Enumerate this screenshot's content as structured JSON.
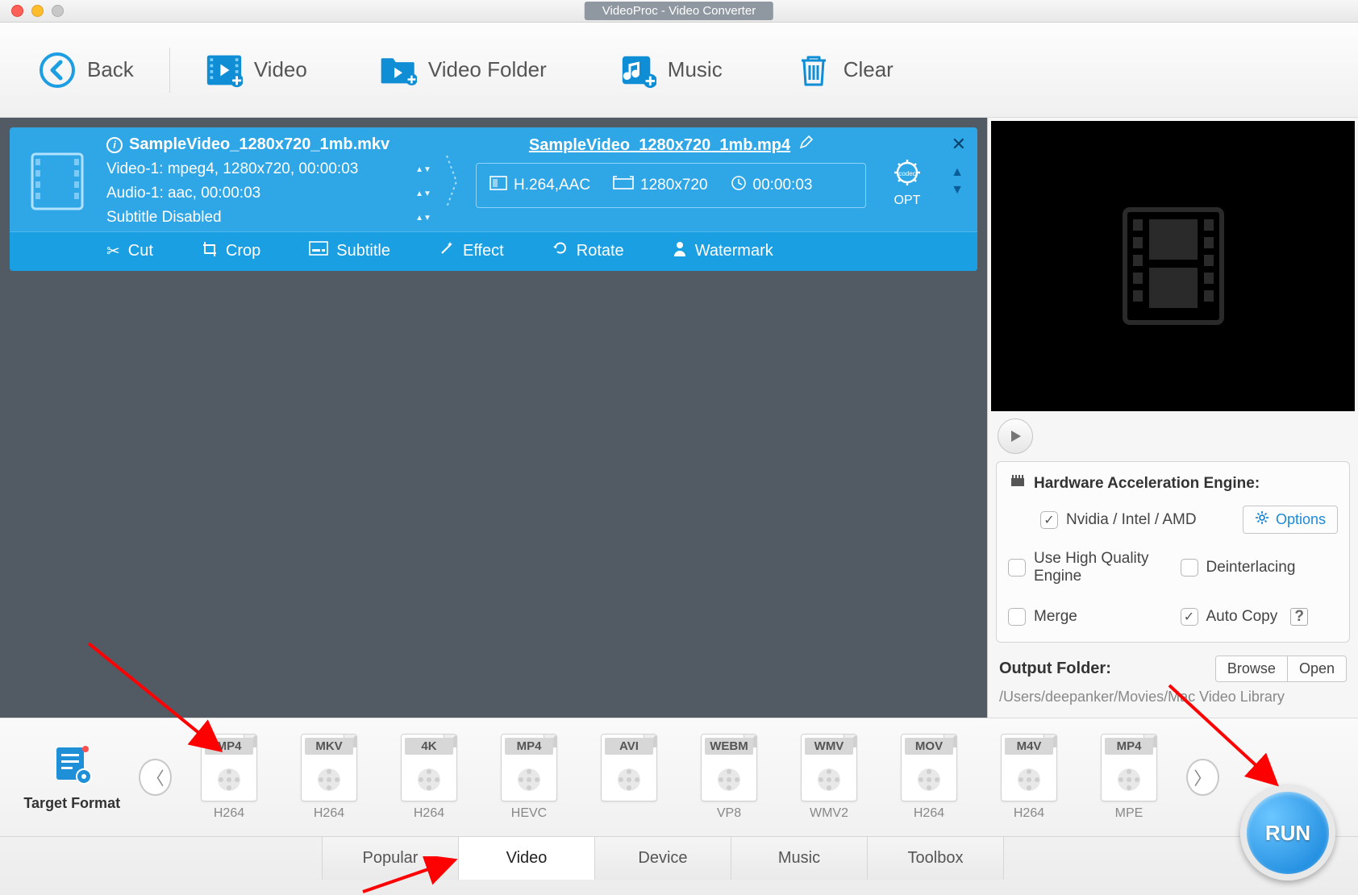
{
  "window": {
    "title": "VideoProc - Video Converter"
  },
  "toolbar": {
    "back": "Back",
    "video": "Video",
    "video_folder": "Video Folder",
    "music": "Music",
    "clear": "Clear"
  },
  "item": {
    "source_name": "SampleVideo_1280x720_1mb.mkv",
    "video_line": "Video-1: mpeg4, 1280x720, 00:00:03",
    "audio_line": "Audio-1: aac, 00:00:03",
    "subtitle_line": "Subtitle Disabled",
    "output_name": "SampleVideo_1280x720_1mb.mp4",
    "codec_summary": "H.264,AAC",
    "resolution": "1280x720",
    "duration": "00:00:03",
    "opt_label": "OPT"
  },
  "edit": {
    "cut": "Cut",
    "crop": "Crop",
    "subtitle": "Subtitle",
    "effect": "Effect",
    "rotate": "Rotate",
    "watermark": "Watermark"
  },
  "accel": {
    "header": "Hardware Acceleration Engine:",
    "nvidia": "Nvidia / Intel / AMD",
    "options": "Options",
    "hq": "Use High Quality Engine",
    "deint": "Deinterlacing",
    "merge": "Merge",
    "autocopy": "Auto Copy"
  },
  "output_folder": {
    "label": "Output Folder:",
    "browse": "Browse",
    "open": "Open",
    "path": "/Users/deepanker/Movies/Mac Video Library"
  },
  "formats": {
    "target_label": "Target Format",
    "items": [
      {
        "top": "MP4",
        "sub": "H264"
      },
      {
        "top": "MKV",
        "sub": "H264"
      },
      {
        "top": "4K",
        "sub": "H264"
      },
      {
        "top": "MP4",
        "sub": "HEVC"
      },
      {
        "top": "AVI",
        "sub": ""
      },
      {
        "top": "WEBM",
        "sub": "VP8"
      },
      {
        "top": "WMV",
        "sub": "WMV2"
      },
      {
        "top": "MOV",
        "sub": "H264"
      },
      {
        "top": "M4V",
        "sub": "H264"
      },
      {
        "top": "MP4",
        "sub": "MPE"
      }
    ]
  },
  "tabs": {
    "popular": "Popular",
    "video": "Video",
    "device": "Device",
    "music": "Music",
    "toolbox": "Toolbox"
  },
  "run": "RUN"
}
